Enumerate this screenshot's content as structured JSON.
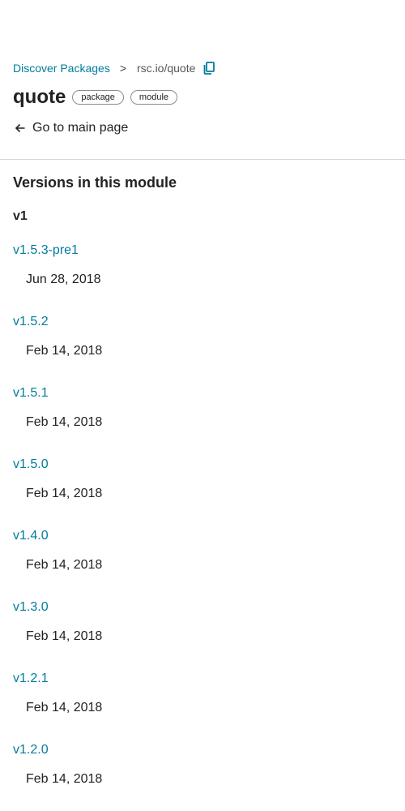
{
  "breadcrumb": {
    "root_label": "Discover Packages",
    "separator": ">",
    "current": "rsc.io/quote"
  },
  "package": {
    "title": "quote",
    "chips": [
      "package",
      "module"
    ]
  },
  "back_link": {
    "label": "Go to main page"
  },
  "versions_section": {
    "title": "Versions in this module",
    "major": "v1",
    "items": [
      {
        "version": "v1.5.3-pre1",
        "date": "Jun 28, 2018"
      },
      {
        "version": "v1.5.2",
        "date": "Feb 14, 2018"
      },
      {
        "version": "v1.5.1",
        "date": "Feb 14, 2018"
      },
      {
        "version": "v1.5.0",
        "date": "Feb 14, 2018"
      },
      {
        "version": "v1.4.0",
        "date": "Feb 14, 2018"
      },
      {
        "version": "v1.3.0",
        "date": "Feb 14, 2018"
      },
      {
        "version": "v1.2.1",
        "date": "Feb 14, 2018"
      },
      {
        "version": "v1.2.0",
        "date": "Feb 14, 2018"
      }
    ]
  },
  "colors": {
    "link": "#007d9c",
    "text": "#202224",
    "divider": "#d5d5d5"
  },
  "icons": {
    "copy": "copy-icon",
    "back": "arrow-left-icon"
  }
}
